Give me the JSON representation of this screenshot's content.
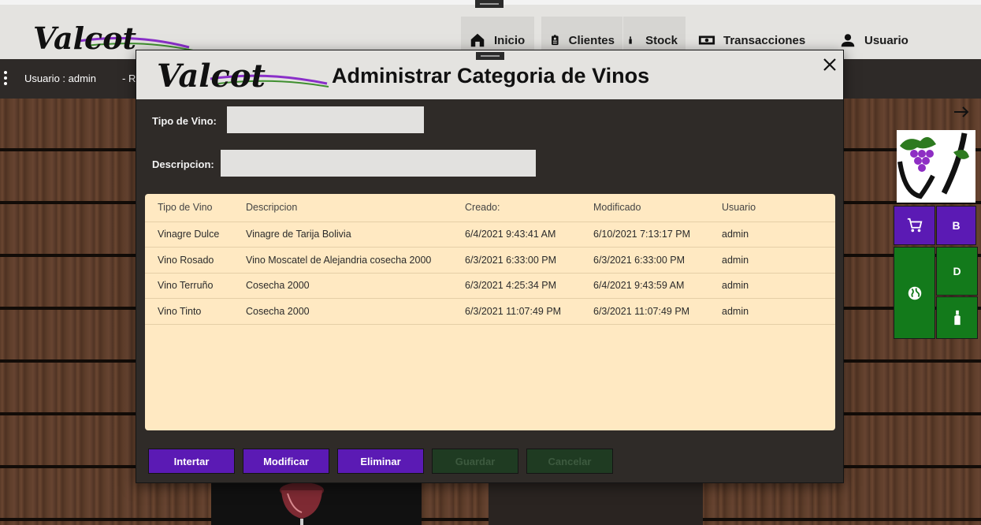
{
  "app": {
    "logo_text": "Valcot"
  },
  "nav": [
    {
      "label": "Inicio",
      "icon": "home-icon"
    },
    {
      "label": "Clientes",
      "icon": "badge-icon"
    },
    {
      "label": "Stock",
      "icon": "bottle-icon"
    },
    {
      "label": "Transacciones",
      "icon": "cash-icon"
    },
    {
      "label": "Usuario",
      "icon": "person-icon"
    }
  ],
  "userbar": {
    "user": "Usuario : admin",
    "role": "- R"
  },
  "side_tiles": {
    "b": "B",
    "d": "D"
  },
  "modal": {
    "title": "Administrar Categoria de Vinos",
    "fields": {
      "tipo_label": "Tipo  de Vino:",
      "tipo_value": "",
      "descripcion_label": "Descripcion:",
      "descripcion_value": ""
    },
    "table": {
      "headers": [
        "Tipo de Vino",
        "Descripcion",
        "Creado:",
        "Modificado",
        "Usuario"
      ],
      "rows": [
        [
          "Vinagre Dulce",
          "Vinagre de Tarija Bolivia",
          "6/4/2021 9:43:41 AM",
          "6/10/2021 7:13:17 PM",
          "admin"
        ],
        [
          "Vino Rosado",
          "Vino Moscatel de Alejandria cosecha 2000",
          "6/3/2021 6:33:00 PM",
          "6/3/2021 6:33:00 PM",
          "admin"
        ],
        [
          "Vino Terruño",
          "Cosecha 2000",
          "6/3/2021 4:25:34 PM",
          "6/4/2021 9:43:59 AM",
          "admin"
        ],
        [
          "Vino Tinto",
          "Cosecha 2000",
          "6/3/2021 11:07:49 PM",
          "6/3/2021 11:07:49 PM",
          "admin"
        ]
      ]
    },
    "buttons": {
      "insert": "Intertar",
      "modify": "Modificar",
      "delete": "Eliminar",
      "save": "Guardar",
      "cancel": "Cancelar"
    }
  },
  "colors": {
    "accent_purple": "#5b1ab4",
    "accent_green": "#137a1b",
    "table_bg": "#ffe9c2"
  }
}
